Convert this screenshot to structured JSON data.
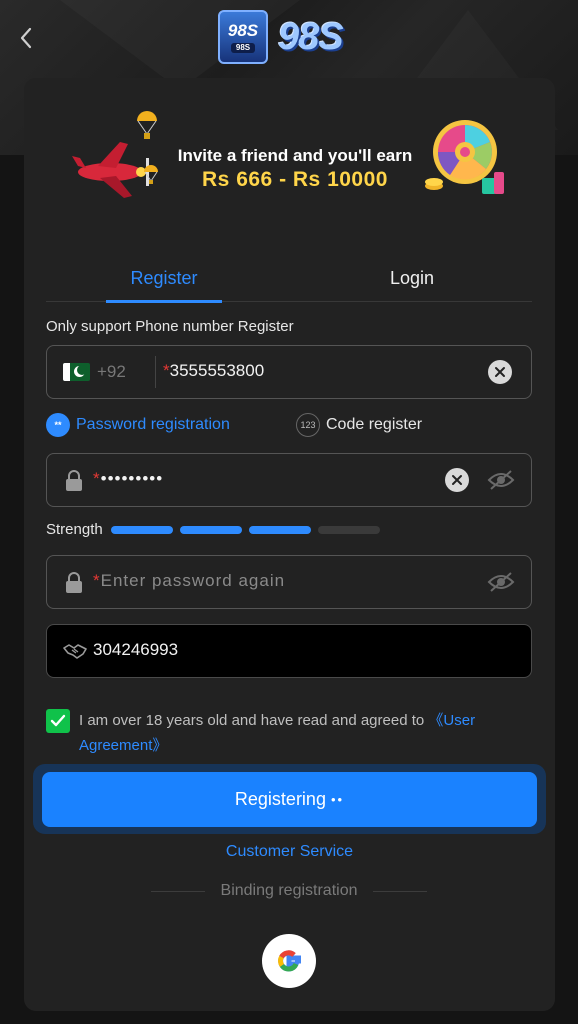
{
  "header": {
    "back_icon": "chevron-left-icon",
    "logo_small_text": "98S",
    "logo_small_sub": "98S",
    "logo_big_text": "98S"
  },
  "banner": {
    "line1": "Invite a friend and you'll earn",
    "line2": "Rs 666 - Rs 10000"
  },
  "tabs": [
    {
      "label": "Register",
      "active": true
    },
    {
      "label": "Login",
      "active": false
    }
  ],
  "form": {
    "support_label": "Only support Phone number Register",
    "country_code": "+92",
    "phone_required_mark": "*",
    "phone_value": "3555553800",
    "modes": {
      "password_label": "Password registration",
      "password_icon_text": "**",
      "code_label": "Code register",
      "code_icon_text": "123"
    },
    "password_required_mark": "*",
    "password_value": "•••••••••",
    "strength_label": "Strength",
    "strength_level": 3,
    "strength_total": 4,
    "confirm_required_mark": "*",
    "confirm_placeholder": "Enter password again",
    "invite_code": "304246993",
    "agreement_text": "I am over 18 years old and have read and agreed to ",
    "agreement_link": "《User Agreement》",
    "agreement_checked": true
  },
  "actions": {
    "register_label": "Registering",
    "register_loading": "••",
    "customer_service": "Customer Service",
    "binding_label": "Binding registration"
  },
  "colors": {
    "accent": "#2e8bff",
    "button": "#1a82ff",
    "check": "#10c24a",
    "required": "#e53935"
  }
}
